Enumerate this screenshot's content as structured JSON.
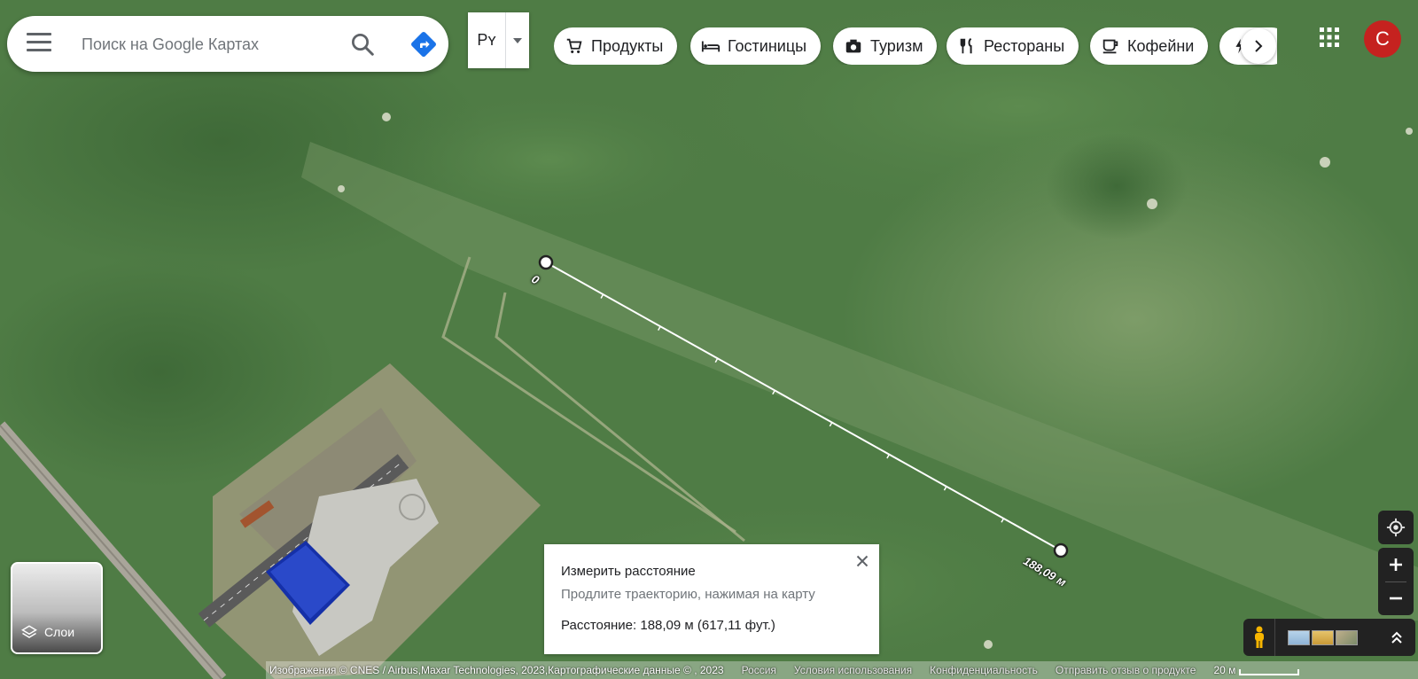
{
  "search": {
    "placeholder": "Поиск на Google Картах"
  },
  "input_tool": {
    "label": "Рʏ"
  },
  "chips": [
    {
      "label": "Продукты",
      "icon": "cart-icon"
    },
    {
      "label": "Гостиницы",
      "icon": "bed-icon"
    },
    {
      "label": "Туризм",
      "icon": "camera-icon"
    },
    {
      "label": "Рестораны",
      "icon": "cutlery-icon"
    },
    {
      "label": "Кофейни",
      "icon": "coffee-cup-icon"
    }
  ],
  "account": {
    "avatar_letter": "C",
    "avatar_color": "#c5221f"
  },
  "layers": {
    "label": "Слои"
  },
  "measure": {
    "title": "Измерить расстояние",
    "hint": "Продлите траекторию, нажимая на карту",
    "distance_text": "Расстояние: 188,09 м (617,11 фут.)",
    "start_label": "0",
    "end_label": "188,09 м"
  },
  "footer": {
    "attribution": "Изображения © CNES / Airbus,Maxar Technologies, 2023,Картографические данные © , 2023",
    "links": [
      "Россия",
      "Условия использования",
      "Конфиденциальность",
      "Отправить отзыв о продукте"
    ],
    "scale_label": "20 м"
  },
  "colors": {
    "accent_blue": "#1a73e8",
    "map_green": "#4f7c45"
  }
}
